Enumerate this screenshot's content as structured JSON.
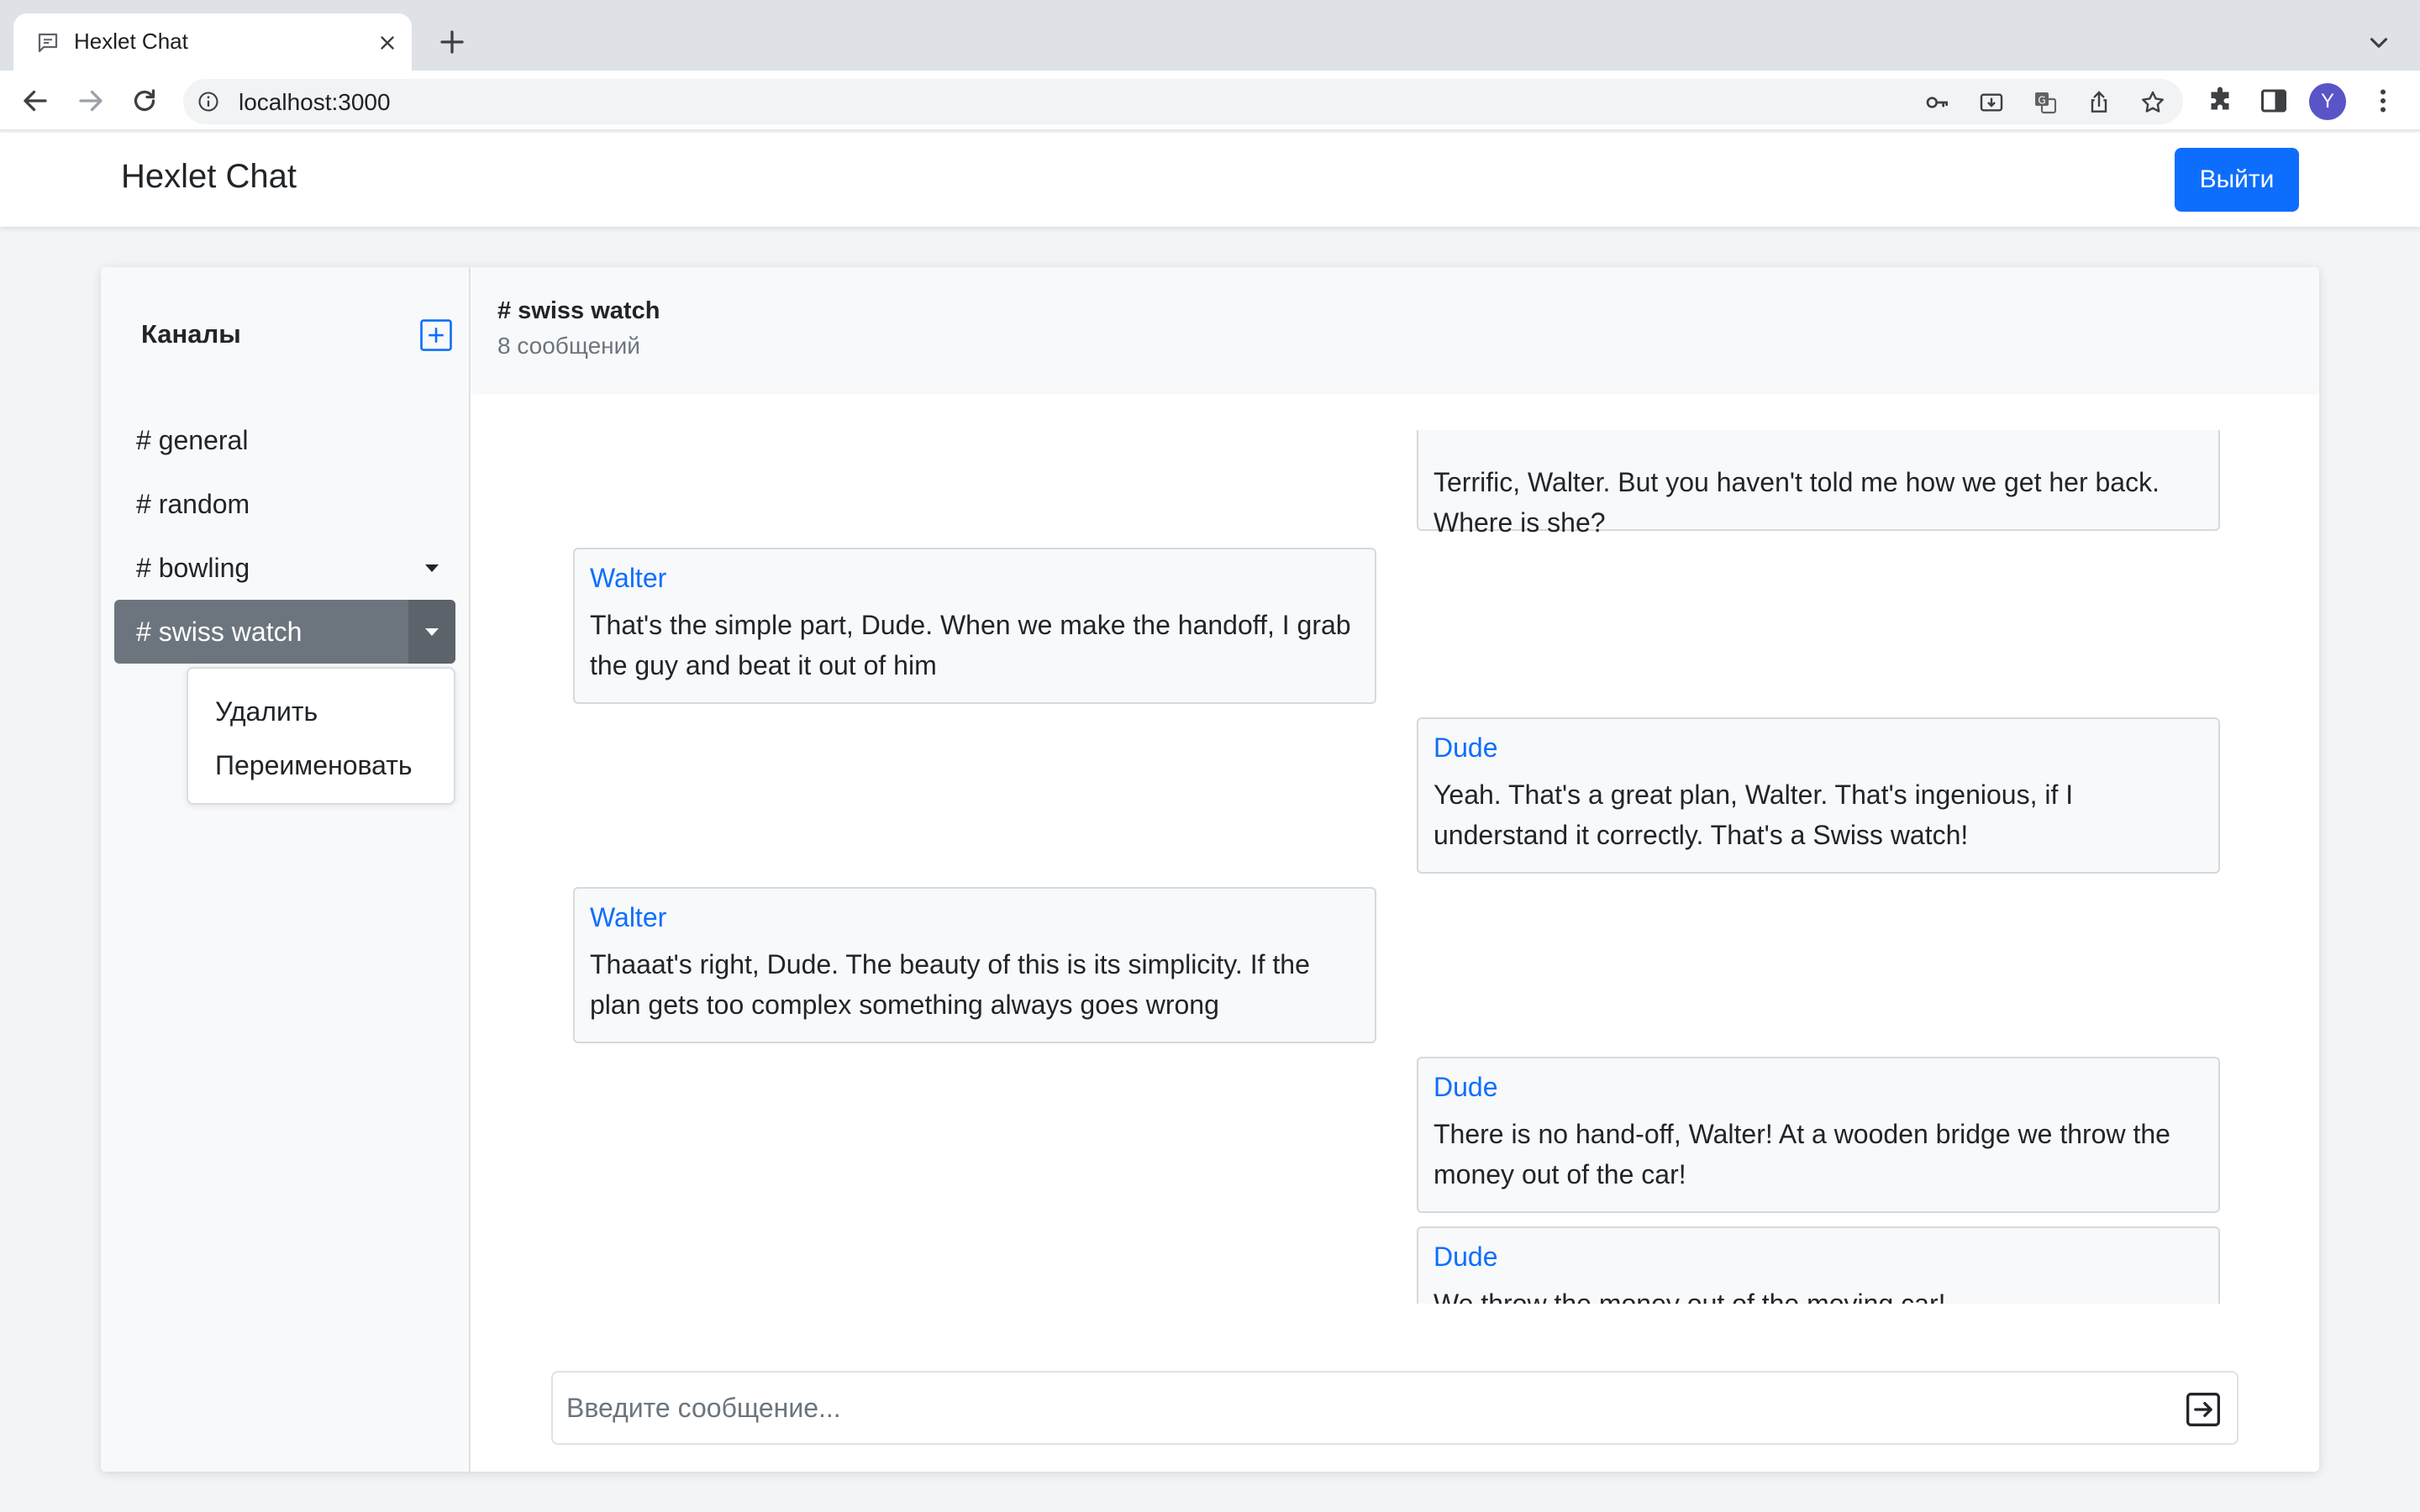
{
  "browser": {
    "tab_title": "Hexlet Chat",
    "url": "localhost:3000",
    "profile_initial": "Y"
  },
  "navbar": {
    "brand": "Hexlet Chat",
    "logout_label": "Выйти"
  },
  "sidebar": {
    "title": "Каналы",
    "channels": [
      {
        "label": "# general"
      },
      {
        "label": "# random"
      },
      {
        "label": "# bowling"
      },
      {
        "label": "# swiss watch"
      }
    ],
    "dropdown": {
      "delete_label": "Удалить",
      "rename_label": "Переименовать"
    }
  },
  "chat": {
    "channel_name": "# swiss watch",
    "message_count": "8 сообщений",
    "messages": [
      {
        "author": "",
        "text": "Terrific, Walter. But you haven't told me how we get her back. Where is she?"
      },
      {
        "author": "Walter",
        "text": "That's the simple part, Dude. When we make the handoff, I grab the guy and beat it out of him"
      },
      {
        "author": "Dude",
        "text": "Yeah. That's a great plan, Walter. That's ingenious, if I understand it correctly. That's a Swiss watch!"
      },
      {
        "author": "Walter",
        "text": "Thaaat's right, Dude. The beauty of this is its simplicity. If the plan gets too complex something always goes wrong"
      },
      {
        "author": "Dude",
        "text": "There is no hand-off, Walter! At a wooden bridge we throw the money out of the car!"
      },
      {
        "author": "Dude",
        "text": "We throw the money out of the moving car!"
      }
    ],
    "input_placeholder": "Введите сообщение..."
  },
  "colors": {
    "primary": "#0d6efd",
    "active_channel": "#6c757d",
    "author": "#0d6efd"
  }
}
